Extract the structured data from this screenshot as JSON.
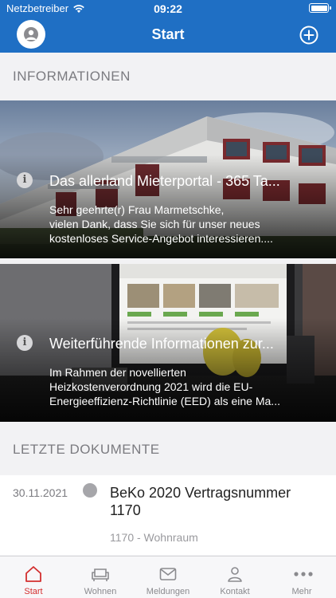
{
  "status_bar": {
    "carrier": "Netzbetreiber",
    "time": "09:22"
  },
  "nav": {
    "title": "Start",
    "avatar_icon": "user-avatar-icon",
    "add_icon": "plus-circle-icon"
  },
  "sections": {
    "informationen": "INFORMATIONEN",
    "letzte_dokumente": "LETZTE DOKUMENTE"
  },
  "info_cards": [
    {
      "title": "Das allerland Mieterportal - 365 Ta...",
      "body_lines": [
        "Sehr geehrte(r) Frau Marmetschke,",
        "vielen Dank, dass Sie sich für unser neues",
        "kostenloses Service-Angebot interessieren...."
      ]
    },
    {
      "title": "Weiterführende Informationen zur...",
      "body_lines": [
        "Im Rahmen der novellierten",
        "Heizkostenverordnung 2021 wird die EU-",
        "Energieeffizienz-Richtlinie (EED) als eine Ma..."
      ]
    }
  ],
  "documents": [
    {
      "date": "30.11.2021",
      "title": "BeKo 2020 Vertragsnummer 1170",
      "subtitle": "1170 - Wohnraum"
    }
  ],
  "tabs": [
    {
      "label": "Start",
      "icon": "home-icon",
      "active": true
    },
    {
      "label": "Wohnen",
      "icon": "sofa-icon",
      "active": false
    },
    {
      "label": "Meldungen",
      "icon": "envelope-icon",
      "active": false
    },
    {
      "label": "Kontakt",
      "icon": "person-icon",
      "active": false
    },
    {
      "label": "Mehr",
      "icon": "more-dots-icon",
      "active": false
    }
  ],
  "colors": {
    "brand_blue": "#1f6fc4",
    "active_tab": "#d32f2f",
    "background": "#f2f2f4"
  }
}
